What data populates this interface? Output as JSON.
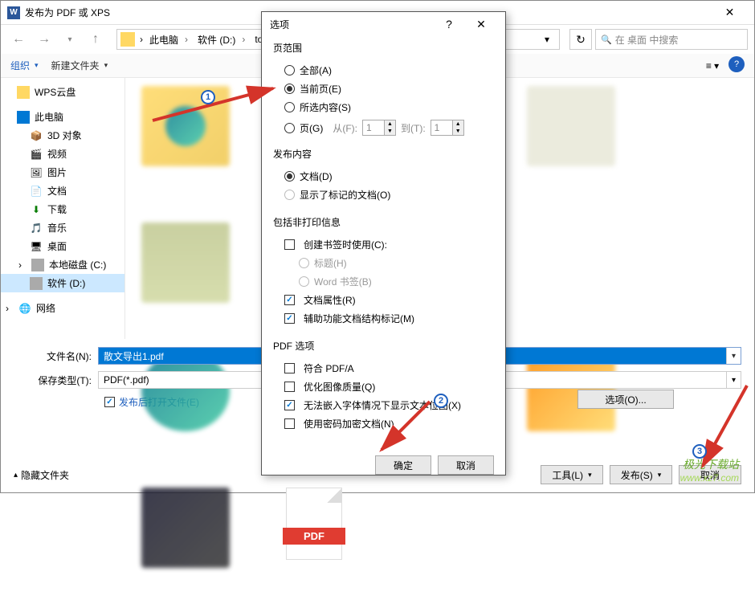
{
  "save_dialog": {
    "title": "发布为 PDF 或 XPS",
    "breadcrumb": {
      "items": [
        "此电脑",
        "软件 (D:)",
        "tools"
      ],
      "dropdown_icon": "chevron-down"
    },
    "search_placeholder": "在 桌面 中搜索",
    "toolbar": {
      "organize": "组织",
      "new_folder": "新建文件夹"
    },
    "sidebar": {
      "items": [
        {
          "label": "WPS云盘",
          "icon": "folder"
        },
        {
          "label": "此电脑",
          "icon": "monitor"
        },
        {
          "label": "3D 对象",
          "icon": "3d"
        },
        {
          "label": "视频",
          "icon": "video"
        },
        {
          "label": "图片",
          "icon": "pic"
        },
        {
          "label": "文档",
          "icon": "doc"
        },
        {
          "label": "下载",
          "icon": "download"
        },
        {
          "label": "音乐",
          "icon": "music"
        },
        {
          "label": "桌面",
          "icon": "desktop"
        },
        {
          "label": "本地磁盘 (C:)",
          "icon": "drive"
        },
        {
          "label": "软件 (D:)",
          "icon": "drive",
          "selected": true
        },
        {
          "label": "网络",
          "icon": "network"
        }
      ]
    },
    "form": {
      "filename_label": "文件名(N):",
      "filename_value": "散文导出1.pdf",
      "savetype_label": "保存类型(T):",
      "savetype_value": "PDF(*.pdf)",
      "open_after_label": "发布后打开文件(E)",
      "options_btn": "选项(O)..."
    },
    "bottom": {
      "hide_folders": "隐藏文件夹",
      "tools": "工具(L)",
      "publish": "发布(S)",
      "cancel": "取消"
    },
    "pdf_badge": "PDF"
  },
  "options_dialog": {
    "title": "选项",
    "sections": {
      "page_range": {
        "title": "页范围",
        "all": "全部(A)",
        "current": "当前页(E)",
        "selection": "所选内容(S)",
        "pages": "页(G)",
        "from_label": "从(F):",
        "from_value": "1",
        "to_label": "到(T):",
        "to_value": "1"
      },
      "publish_content": {
        "title": "发布内容",
        "document": "文档(D)",
        "marked_up": "显示了标记的文档(O)"
      },
      "nonprint": {
        "title": "包括非打印信息",
        "bookmarks": "创建书签时使用(C):",
        "headings": "标题(H)",
        "word_bookmarks": "Word 书签(B)",
        "doc_props": "文档属性(R)",
        "accessibility": "辅助功能文档结构标记(M)"
      },
      "pdf_options": {
        "title": "PDF 选项",
        "pdfa": "符合 PDF/A",
        "image_quality": "优化图像质量(Q)",
        "bitmap_text": "无法嵌入字体情况下显示文本位图(X)",
        "encrypt": "使用密码加密文档(N)"
      }
    },
    "buttons": {
      "ok": "确定",
      "cancel": "取消"
    }
  },
  "annotations": {
    "badge1": "1",
    "badge2": "2",
    "badge3": "3"
  },
  "watermark": {
    "line1": "极光下载站",
    "line2": "www.xz7.com"
  }
}
